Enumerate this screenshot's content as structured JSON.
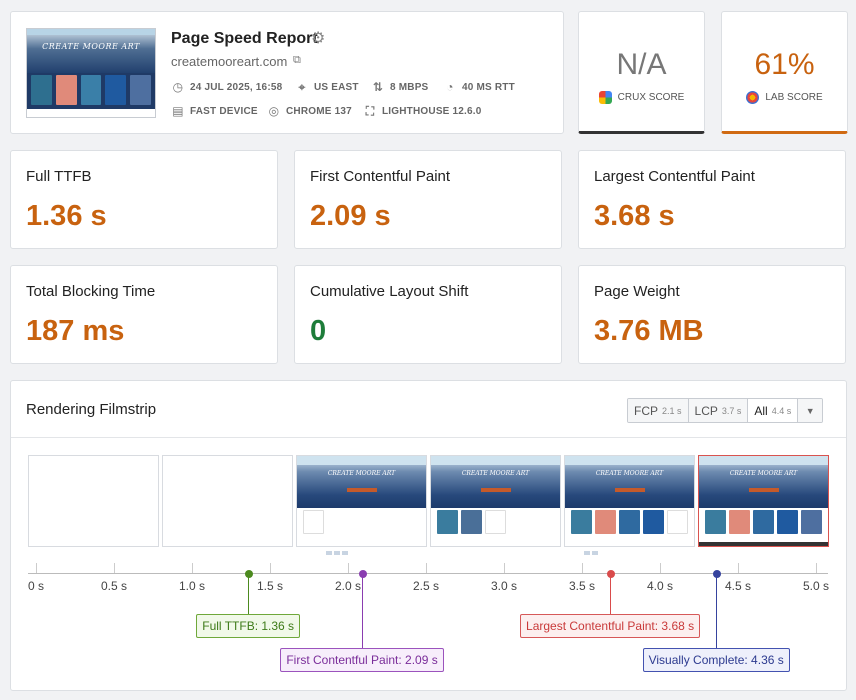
{
  "header": {
    "title": "Page Speed Report",
    "domain": "createmooreart.com",
    "thumbnail_title": "CREATE MOORE ART",
    "meta": [
      {
        "icon": "clock-icon",
        "text": "24 JUL 2025, 16:58"
      },
      {
        "icon": "location-pin-icon",
        "text": "US EAST"
      },
      {
        "icon": "bandwidth-arrows-icon",
        "text": "8 MBPS"
      },
      {
        "icon": "gauge-icon",
        "text": "40 MS RTT"
      },
      {
        "icon": "device-icon",
        "text": "FAST DEVICE"
      },
      {
        "icon": "chrome-icon",
        "text": "CHROME 137"
      },
      {
        "icon": "lighthouse-icon",
        "text": "LIGHTHOUSE 12.6.0"
      }
    ]
  },
  "scores": {
    "crux": {
      "value": "N/A",
      "label": "CRUX SCORE"
    },
    "lab": {
      "value": "61%",
      "label": "LAB SCORE"
    }
  },
  "metrics": [
    {
      "name": "Full TTFB",
      "value": "1.36 s",
      "status": "needs-improvement"
    },
    {
      "name": "First Contentful Paint",
      "value": "2.09 s",
      "status": "needs-improvement"
    },
    {
      "name": "Largest Contentful Paint",
      "value": "3.68 s",
      "status": "needs-improvement"
    },
    {
      "name": "Total Blocking Time",
      "value": "187 ms",
      "status": "needs-improvement"
    },
    {
      "name": "Cumulative Layout Shift",
      "value": "0",
      "status": "good"
    },
    {
      "name": "Page Weight",
      "value": "3.76 MB",
      "status": "needs-improvement"
    }
  ],
  "filmstrip": {
    "title": "Rendering Filmstrip",
    "tabs": [
      {
        "label": "FCP",
        "sub": "2.1 s"
      },
      {
        "label": "LCP",
        "sub": "3.7 s"
      },
      {
        "label": "All",
        "sub": "4.4 s",
        "active": true
      }
    ],
    "frame_title": "CREATE MOORE ART",
    "axis_ticks": [
      "0 s",
      "0.5 s",
      "1.0 s",
      "1.5 s",
      "2.0 s",
      "2.5 s",
      "3.0 s",
      "3.5 s",
      "4.0 s",
      "4.5 s",
      "5.0 s"
    ],
    "axis_max_s": 5.0,
    "markers": [
      {
        "key": "ttfb",
        "label": "Full TTFB: 1.36 s",
        "time_s": 1.36,
        "color": "#4c8a1f"
      },
      {
        "key": "fcp",
        "label": "First Contentful Paint: 2.09 s",
        "time_s": 2.09,
        "color": "#8a3db0"
      },
      {
        "key": "lcp",
        "label": "Largest Contentful Paint: 3.68 s",
        "time_s": 3.68,
        "color": "#d94b4b"
      },
      {
        "key": "vc",
        "label": "Visually Complete: 4.36 s",
        "time_s": 4.36,
        "color": "#36439e"
      }
    ]
  },
  "colors": {
    "accent_orange": "#c8620f",
    "good_green": "#1e7d3a"
  }
}
